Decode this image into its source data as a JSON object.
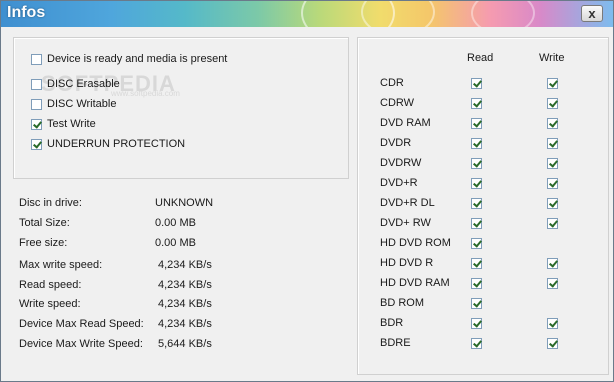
{
  "window": {
    "title": "Infos"
  },
  "title_buttons": {
    "close": "x"
  },
  "watermark": {
    "brand": "SOFTPEDIA",
    "url": "www.softpedia.com"
  },
  "status": [
    {
      "label": "Device is ready and media is present",
      "checked": false
    },
    {
      "label": "DISC Erasable",
      "checked": false
    },
    {
      "label": "DISC Writable",
      "checked": false
    },
    {
      "label": "Test Write",
      "checked": true
    },
    {
      "label": "UNDERRUN PROTECTION",
      "checked": true
    }
  ],
  "info": [
    {
      "label": "Disc in drive:",
      "value": "UNKNOWN"
    },
    {
      "label": "Total Size:",
      "value": "0.00 MB"
    },
    {
      "label": "Free size:",
      "value": "0.00 MB"
    },
    {
      "label": "Max write speed:",
      "value": "4,234 KB/s"
    },
    {
      "label": "Read speed:",
      "value": "4,234 KB/s"
    },
    {
      "label": "Write speed:",
      "value": "4,234 KB/s"
    },
    {
      "label": "Device Max Read Speed:",
      "value": "4,234 KB/s"
    },
    {
      "label": "Device Max Write Speed:",
      "value": "5,644 KB/s"
    }
  ],
  "capabilities": {
    "read_header": "Read",
    "write_header": "Write",
    "rows": [
      {
        "name": "CDR",
        "read": true,
        "write": true
      },
      {
        "name": "CDRW",
        "read": true,
        "write": true
      },
      {
        "name": "DVD RAM",
        "read": true,
        "write": true
      },
      {
        "name": "DVDR",
        "read": true,
        "write": true
      },
      {
        "name": "DVDRW",
        "read": true,
        "write": true
      },
      {
        "name": "DVD+R",
        "read": true,
        "write": true
      },
      {
        "name": "DVD+R DL",
        "read": true,
        "write": true
      },
      {
        "name": "DVD+ RW",
        "read": true,
        "write": true
      },
      {
        "name": "HD DVD ROM",
        "read": true,
        "write": null
      },
      {
        "name": "HD DVD R",
        "read": true,
        "write": true
      },
      {
        "name": "HD DVD RAM",
        "read": true,
        "write": true
      },
      {
        "name": "BD ROM",
        "read": true,
        "write": null
      },
      {
        "name": "BDR",
        "read": true,
        "write": true
      },
      {
        "name": "BDRE",
        "read": true,
        "write": true
      }
    ]
  }
}
